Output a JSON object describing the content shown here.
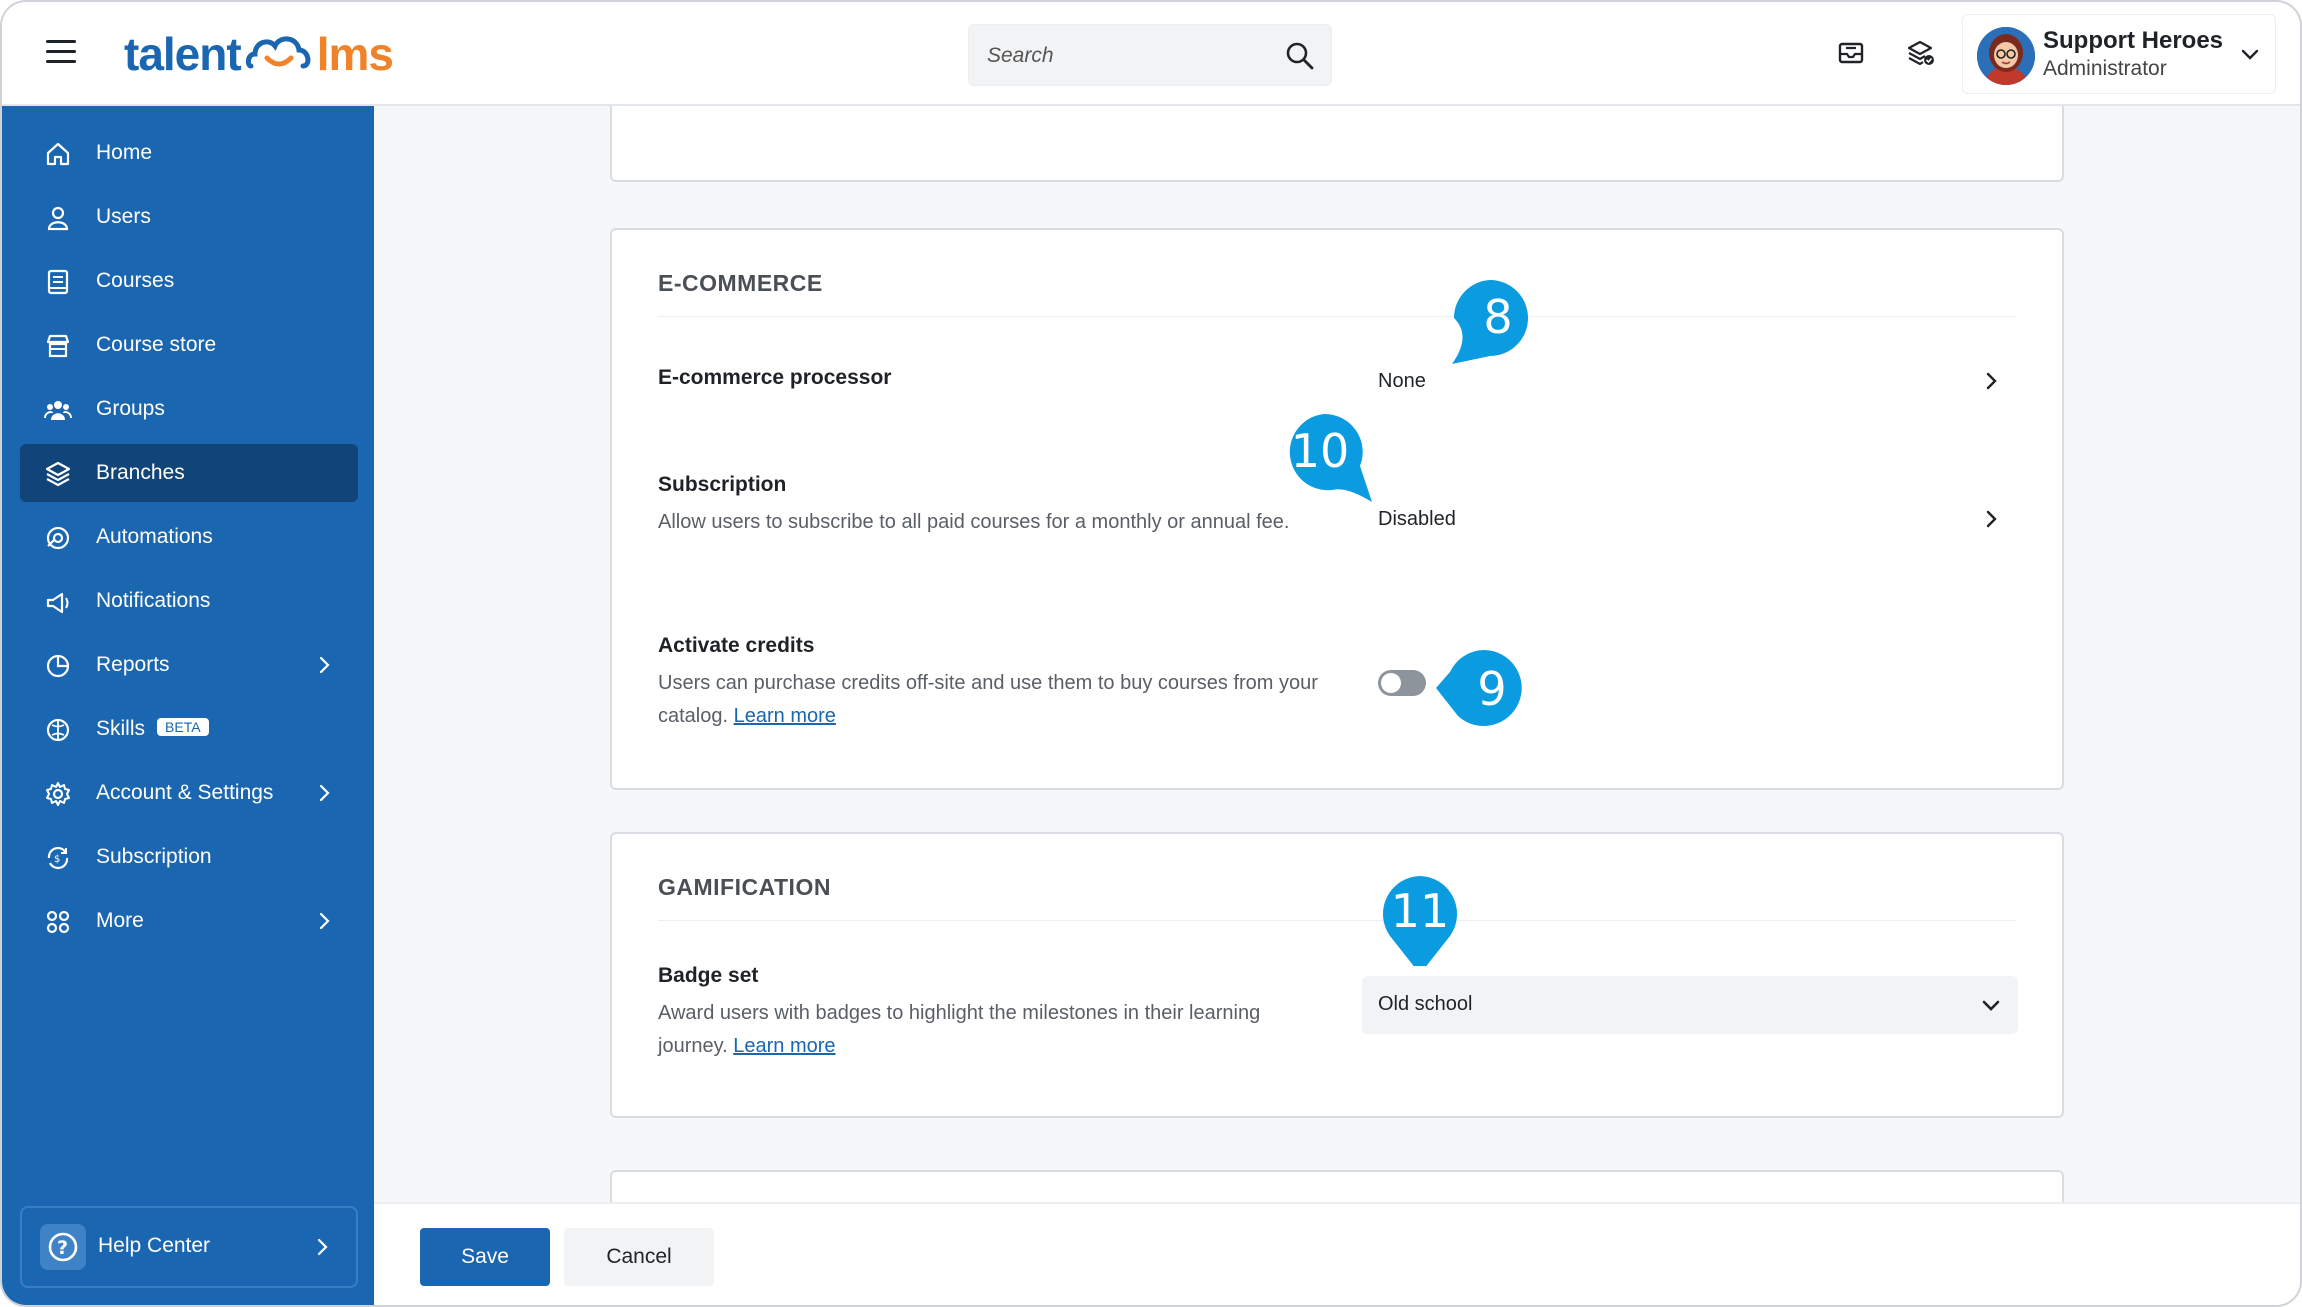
{
  "header": {
    "logo_left": "talent",
    "logo_right": "lms",
    "search_placeholder": "Search",
    "user_name": "Support Heroes",
    "user_role": "Administrator"
  },
  "sidebar": {
    "items": [
      {
        "label": "Home",
        "icon": "home-icon"
      },
      {
        "label": "Users",
        "icon": "user-icon"
      },
      {
        "label": "Courses",
        "icon": "book-icon"
      },
      {
        "label": "Course store",
        "icon": "store-icon"
      },
      {
        "label": "Groups",
        "icon": "groups-icon"
      },
      {
        "label": "Branches",
        "icon": "layers-icon",
        "active": true
      },
      {
        "label": "Automations",
        "icon": "automation-icon"
      },
      {
        "label": "Notifications",
        "icon": "megaphone-icon"
      },
      {
        "label": "Reports",
        "icon": "pie-chart-icon",
        "has_chevron": true
      },
      {
        "label": "Skills",
        "icon": "brain-icon",
        "badge": "BETA"
      },
      {
        "label": "Account & Settings",
        "icon": "gear-icon",
        "has_chevron": true
      },
      {
        "label": "Subscription",
        "icon": "refresh-dollar-icon"
      },
      {
        "label": "More",
        "icon": "grid-icon",
        "has_chevron": true
      }
    ],
    "help_label": "Help Center"
  },
  "ecommerce": {
    "title": "E-COMMERCE",
    "processor_label": "E-commerce processor",
    "processor_value": "None",
    "subscription_label": "Subscription",
    "subscription_desc": "Allow users to subscribe to all paid courses for a monthly or annual fee.",
    "subscription_value": "Disabled",
    "credits_label": "Activate credits",
    "credits_desc": "Users can purchase credits off-site and use them to buy courses from your catalog.",
    "credits_link": "Learn more",
    "credits_enabled": false
  },
  "gamification": {
    "title": "GAMIFICATION",
    "badge_label": "Badge set",
    "badge_desc": "Award users with badges to highlight the milestones in their learning journey.",
    "badge_link": "Learn more",
    "badge_value": "Old school"
  },
  "footer": {
    "save_label": "Save",
    "cancel_label": "Cancel"
  },
  "callouts": {
    "c8": "8",
    "c9": "9",
    "c10": "10",
    "c11": "11"
  },
  "colors": {
    "brand_blue": "#1a66b0",
    "brand_orange": "#f0832a",
    "sidebar_active": "#11457a",
    "callout_blue": "#0a9be0"
  }
}
